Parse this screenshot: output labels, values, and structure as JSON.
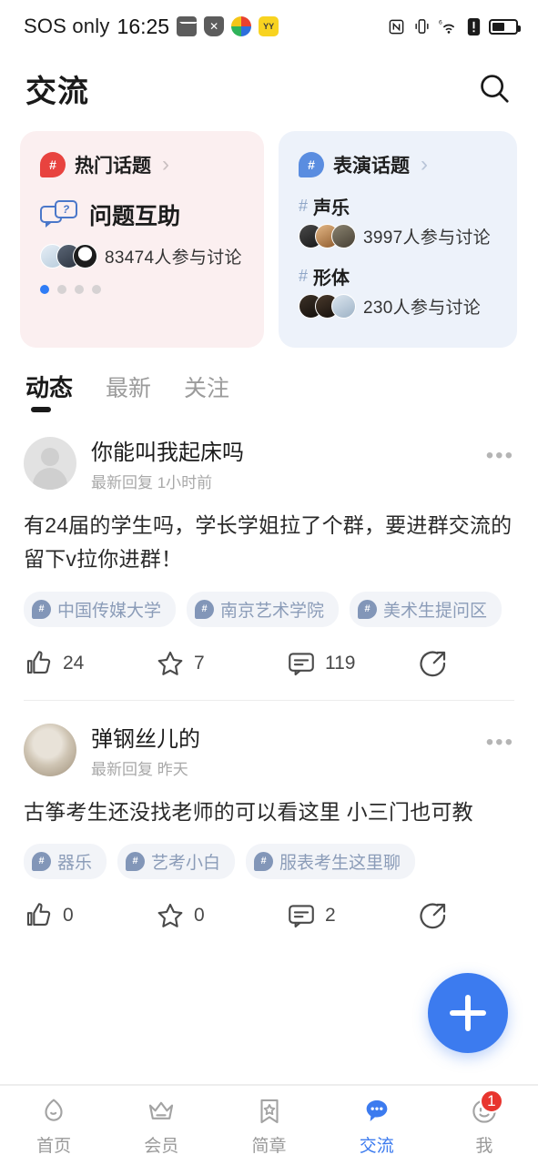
{
  "status_bar": {
    "carrier": "SOS only",
    "time": "16:25",
    "left_icons": [
      "mail-icon",
      "shield-block-icon",
      "color-app-icon",
      "yy-app-icon"
    ],
    "right_icons": [
      "nfc-icon",
      "vibrate-icon",
      "wifi-6-icon",
      "alert-icon",
      "battery-icon"
    ],
    "nfc_glyph": "Ⓝ",
    "vibrate_glyph": "📳",
    "wifi_glyph": "ᶟ",
    "alert_glyph": "❗"
  },
  "header": {
    "title": "交流",
    "search_icon": "search-icon"
  },
  "topic_cards": [
    {
      "id": "hot-topics",
      "badge_symbol": "#",
      "title": "热门话题",
      "chevron": "›",
      "featured_title": "问题互助",
      "featured_icon_symbol": "?",
      "participants": "83474人参与讨论",
      "avatars": [
        "#cfd8e6",
        "#3c4756",
        "#1f1f1f"
      ],
      "pager": {
        "count": 4,
        "active": 0
      },
      "bg_color": "#FBEFF0",
      "badge_color": "#e8433f"
    },
    {
      "id": "performance-topics",
      "badge_symbol": "#",
      "title": "表演话题",
      "chevron": "›",
      "bg_color": "#EDF2FA",
      "badge_color": "#5a8de0",
      "topics": [
        {
          "hash": "#",
          "name": "声乐",
          "participants": "3997人参与讨论",
          "avatars": [
            "#2b2b2b",
            "#c58d5a",
            "#6b6355"
          ]
        },
        {
          "hash": "#",
          "name": "形体",
          "participants": "230人参与讨论",
          "avatars": [
            "#2a2118",
            "#3a2c20",
            "#aebfcf"
          ]
        }
      ]
    }
  ],
  "feed_tabs": [
    {
      "label": "动态",
      "active": true
    },
    {
      "label": "最新",
      "active": false
    },
    {
      "label": "关注",
      "active": false
    }
  ],
  "posts": [
    {
      "user": "你能叫我起床吗",
      "time": "最新回复 1小时前",
      "more": "•••",
      "body": "有24届的学生吗，学长学姐拉了个群，要进群交流的留下v拉你进群！",
      "tags": [
        "中国传媒大学",
        "南京艺术学院",
        "美术生提问区"
      ],
      "likes": "24",
      "favorites": "7",
      "comments": "119",
      "share_icon": "share-icon",
      "avatar_type": "placeholder"
    },
    {
      "user": "弹钢丝儿的",
      "time": "最新回复 昨天",
      "more": "•••",
      "body": "古筝考生还没找老师的可以看这里 小三门也可教",
      "tags": [
        "器乐",
        "艺考小白",
        "服表考生这里聊"
      ],
      "likes": "0",
      "favorites": "0",
      "comments": "2",
      "share_icon": "share-icon",
      "avatar_type": "cat-photo"
    }
  ],
  "fab": {
    "icon": "plus-icon",
    "color": "#3C7BEF"
  },
  "bottom_nav": [
    {
      "label": "首页",
      "icon": "home-icon",
      "active": false,
      "badge": ""
    },
    {
      "label": "会员",
      "icon": "crown-icon",
      "active": false,
      "badge": ""
    },
    {
      "label": "简章",
      "icon": "bookmark-star-icon",
      "active": false,
      "badge": ""
    },
    {
      "label": "交流",
      "icon": "chat-bubble-icon",
      "active": true,
      "badge": ""
    },
    {
      "label": "我",
      "icon": "profile-smile-icon",
      "active": false,
      "badge": "1"
    }
  ],
  "colors": {
    "accent_blue": "#3C7BEF",
    "badge_red": "#e8352f",
    "card_pink": "#FBEFF0",
    "card_blue": "#EDF2FA",
    "tag_bg": "#F2F4F8",
    "tag_text": "#8b9cb8"
  }
}
